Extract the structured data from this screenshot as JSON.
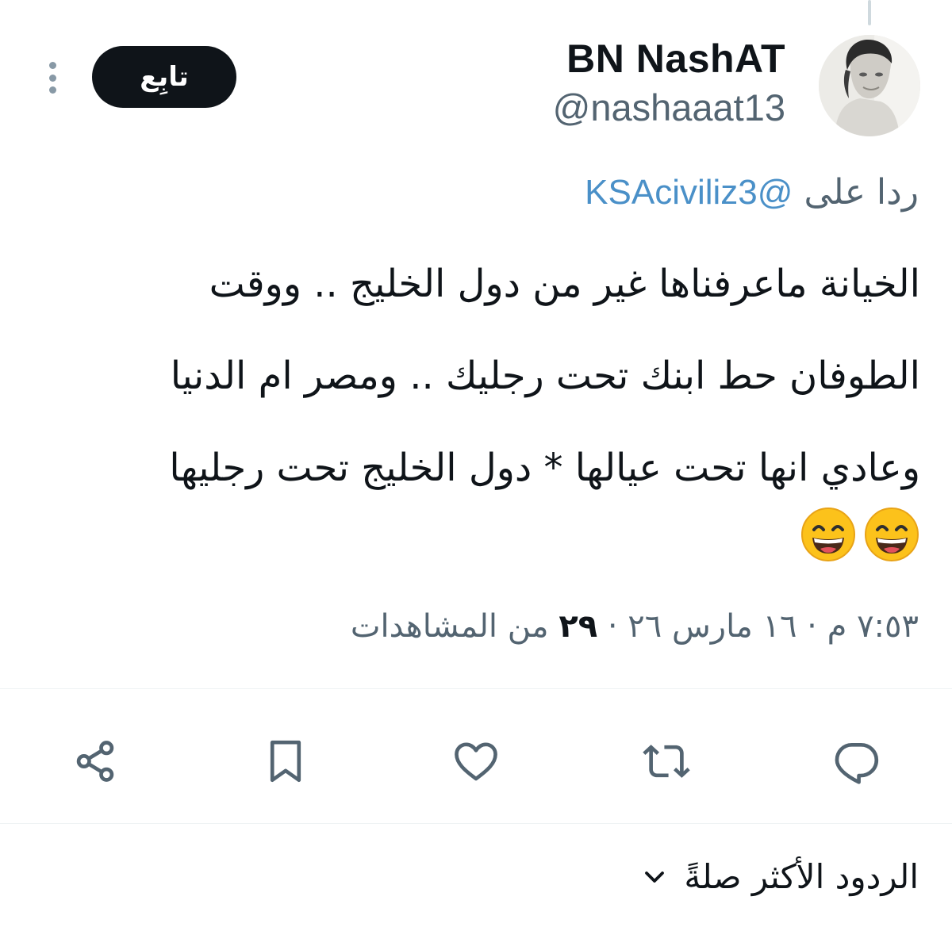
{
  "author": {
    "display_name": "BN NashAT",
    "handle": "@nashaaat13"
  },
  "header": {
    "follow_label": "تابِع",
    "more_icon": "more-vertical-icon"
  },
  "reply": {
    "prefix": "ردا على",
    "mention": "@KSAciviliz3"
  },
  "tweet": {
    "lines": [
      "الخيانة ماعرفناها غير من دول الخليج .. ووقت",
      "الطوفان حط ابنك تحت رجليك .. ومصر ام الدنيا",
      "وعادي انها تحت عيالها * دول الخليج تحت رجليها"
    ],
    "emojis": [
      "grinning-face-with-smiling-eyes",
      "grinning-face-with-smiling-eyes"
    ]
  },
  "meta": {
    "time": "٧:٥٣ م",
    "separator": "·",
    "date": "١٦ مارس ٢٦",
    "views_count": "٢٩",
    "views_label": "من المشاهدات"
  },
  "actions": [
    {
      "name": "reply",
      "icon": "reply-icon"
    },
    {
      "name": "retweet",
      "icon": "retweet-icon"
    },
    {
      "name": "like",
      "icon": "heart-icon"
    },
    {
      "name": "bookmark",
      "icon": "bookmark-icon"
    },
    {
      "name": "share",
      "icon": "share-icon"
    }
  ],
  "replies_sort": {
    "label": "الردود الأكثر صلةً",
    "icon": "chevron-down-icon"
  },
  "colors": {
    "text_primary": "#0f1419",
    "text_secondary": "#536471",
    "mention": "#4a90c8",
    "icon": "#536471",
    "follow_bg": "#0f1419"
  }
}
